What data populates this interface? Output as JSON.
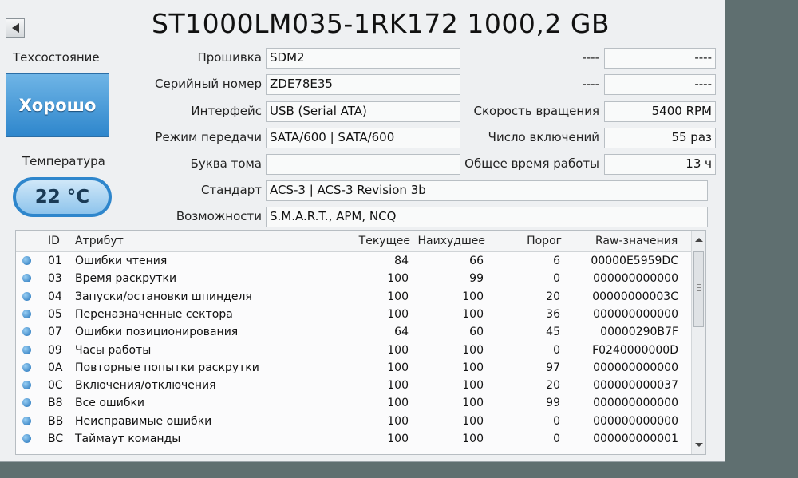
{
  "title": "ST1000LM035-1RK172 1000,2 GB",
  "health": {
    "label": "Техсостояние",
    "value": "Хорошо"
  },
  "temperature": {
    "label": "Температура",
    "value": "22 °C"
  },
  "fields_left": [
    {
      "label": "Прошивка",
      "value": "SDM2"
    },
    {
      "label": "Серийный номер",
      "value": "ZDE78E35"
    },
    {
      "label": "Интерфейс",
      "value": "USB (Serial ATA)"
    },
    {
      "label": "Режим передачи",
      "value": "SATA/600 | SATA/600"
    },
    {
      "label": "Буква тома",
      "value": ""
    },
    {
      "label": "Стандарт",
      "value": "ACS-3 | ACS-3 Revision 3b"
    },
    {
      "label": "Возможности",
      "value": "S.M.A.R.T., APM, NCQ"
    }
  ],
  "fields_right": [
    {
      "label": "----",
      "value": "----"
    },
    {
      "label": "----",
      "value": "----"
    },
    {
      "label": "Скорость вращения",
      "value": "5400 RPM"
    },
    {
      "label": "Число включений",
      "value": "55 раз"
    },
    {
      "label": "Общее время работы",
      "value": "13 ч"
    }
  ],
  "table": {
    "headers": [
      "ID",
      "Атрибут",
      "Текущее",
      "Наихудшее",
      "Порог",
      "Raw-значения"
    ],
    "rows": [
      [
        "01",
        "Ошибки чтения",
        "84",
        "66",
        "6",
        "00000E5959DC"
      ],
      [
        "03",
        "Время раскрутки",
        "100",
        "99",
        "0",
        "000000000000"
      ],
      [
        "04",
        "Запуски/остановки шпинделя",
        "100",
        "100",
        "20",
        "00000000003C"
      ],
      [
        "05",
        "Переназначенные сектора",
        "100",
        "100",
        "36",
        "000000000000"
      ],
      [
        "07",
        "Ошибки позиционирования",
        "64",
        "60",
        "45",
        "00000290B7F"
      ],
      [
        "09",
        "Часы работы",
        "100",
        "100",
        "0",
        "F0240000000D"
      ],
      [
        "0A",
        "Повторные попытки раскрутки",
        "100",
        "100",
        "97",
        "000000000000"
      ],
      [
        "0C",
        "Включения/отключения",
        "100",
        "100",
        "20",
        "000000000037"
      ],
      [
        "B8",
        "Все ошибки",
        "100",
        "100",
        "99",
        "000000000000"
      ],
      [
        "BB",
        "Неисправимые ошибки",
        "100",
        "100",
        "0",
        "000000000000"
      ],
      [
        "BC",
        "Таймаут команды",
        "100",
        "100",
        "0",
        "000000000001"
      ]
    ]
  },
  "colors": {
    "health_bg": "#2e86cc",
    "status_dot": "#1f6fb7"
  },
  "icons": {
    "prev": "triangle-left-icon",
    "status": "blue-dot-icon"
  }
}
